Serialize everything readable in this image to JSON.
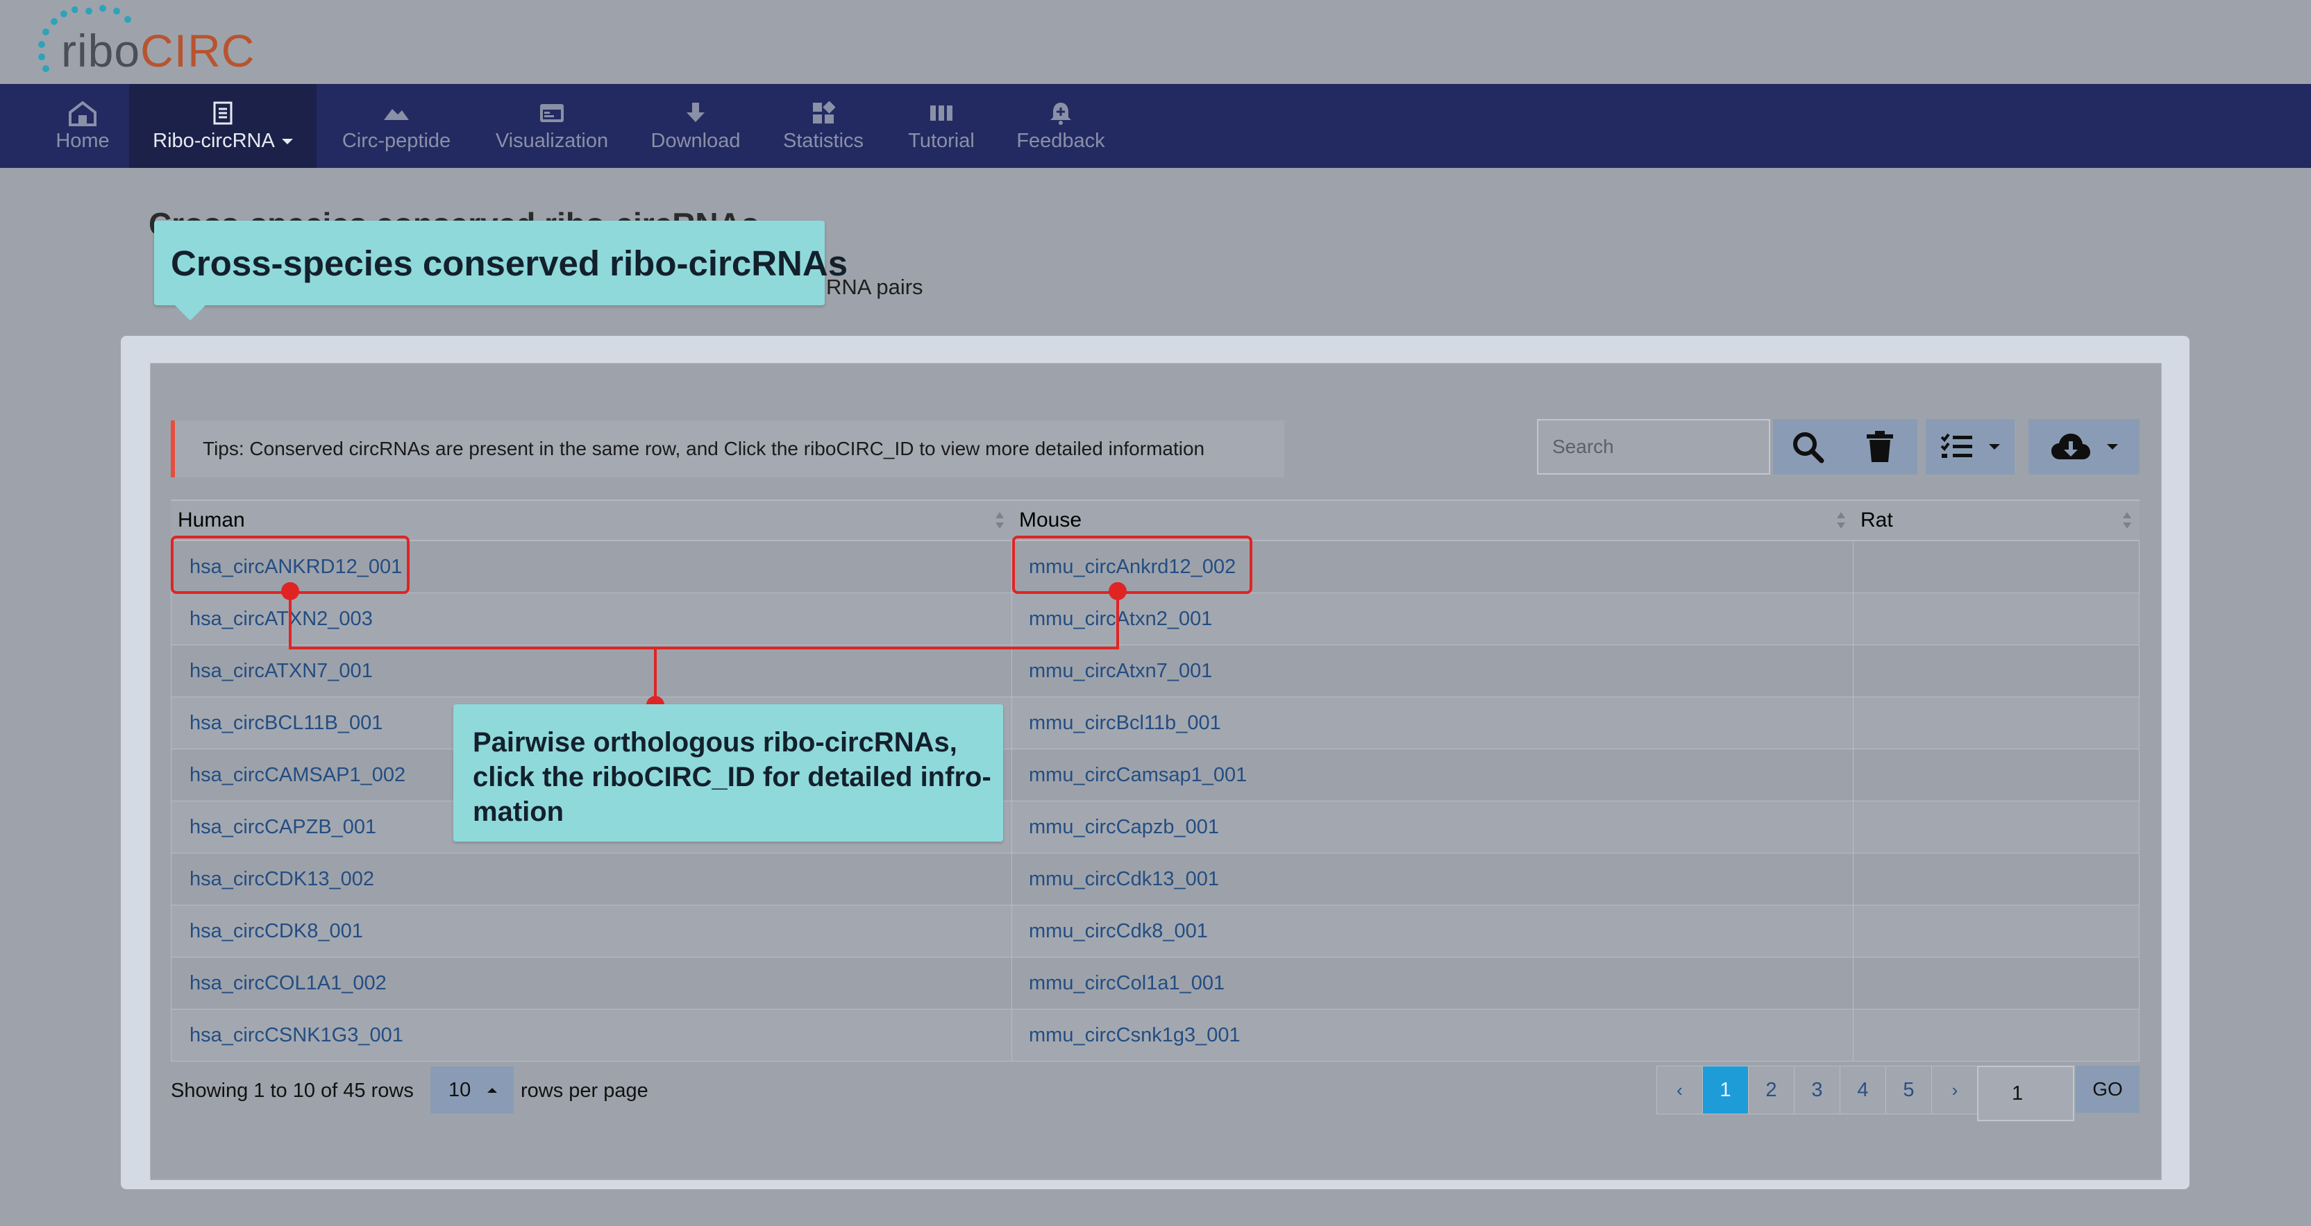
{
  "app": {
    "logo_ribo": "ribo",
    "logo_circ": "CIRC"
  },
  "nav": {
    "items": [
      {
        "label": "Home",
        "icon": "home-icon"
      },
      {
        "label": "Ribo-circRNA",
        "icon": "document-icon",
        "active": true,
        "has_dropdown": true
      },
      {
        "label": "Circ-peptide",
        "icon": "mountain-icon"
      },
      {
        "label": "Visualization",
        "icon": "browser-window-icon"
      },
      {
        "label": "Download",
        "icon": "download-arrow-icon"
      },
      {
        "label": "Statistics",
        "icon": "grid-blocks-icon"
      },
      {
        "label": "Tutorial",
        "icon": "columns-icon"
      },
      {
        "label": "Feedback",
        "icon": "bell-plus-icon"
      }
    ]
  },
  "page": {
    "title": "Cross-species conserved ribo-circRNAs",
    "subtitle_visible": "RNA pairs"
  },
  "tips": "Tips: Conserved circRNAs are present in the same row, and Click the riboCIRC_ID to view more detailed information",
  "toolbar": {
    "search_placeholder": "Search",
    "search_icon": "search-icon",
    "clear_icon": "trash-icon",
    "columns_icon": "list-checks-icon",
    "export_icon": "cloud-download-icon"
  },
  "table": {
    "columns": [
      "Human",
      "Mouse",
      "Rat"
    ],
    "rows": [
      {
        "human": "hsa_circANKRD12_001",
        "mouse": "mmu_circAnkrd12_002",
        "rat": ""
      },
      {
        "human": "hsa_circATXN2_003",
        "mouse": "mmu_circAtxn2_001",
        "rat": ""
      },
      {
        "human": "hsa_circATXN7_001",
        "mouse": "mmu_circAtxn7_001",
        "rat": ""
      },
      {
        "human": "hsa_circBCL11B_001",
        "mouse": "mmu_circBcl11b_001",
        "rat": ""
      },
      {
        "human": "hsa_circCAMSAP1_002",
        "mouse": "mmu_circCamsap1_001",
        "rat": ""
      },
      {
        "human": "hsa_circCAPZB_001",
        "mouse": "mmu_circCapzb_001",
        "rat": ""
      },
      {
        "human": "hsa_circCDK13_002",
        "mouse": "mmu_circCdk13_001",
        "rat": ""
      },
      {
        "human": "hsa_circCDK8_001",
        "mouse": "mmu_circCdk8_001",
        "rat": ""
      },
      {
        "human": "hsa_circCOL1A1_002",
        "mouse": "mmu_circCol1a1_001",
        "rat": ""
      },
      {
        "human": "hsa_circCSNK1G3_001",
        "mouse": "mmu_circCsnk1g3_001",
        "rat": ""
      }
    ]
  },
  "footer": {
    "showing": "Showing 1 to 10 of 45 rows",
    "page_size": "10",
    "rows_per_page": "rows per page",
    "prev": "‹",
    "next": "›",
    "pages": [
      "1",
      "2",
      "3",
      "4",
      "5"
    ],
    "current_page": "1",
    "goto_value": "1",
    "go_label": "GO"
  },
  "annotations": {
    "title_callout": "Cross-species conserved ribo-circRNAs",
    "pair_callout_lines": [
      "Pairwise orthologous ribo-circRNAs,",
      "click the riboCIRC_ID for detailed infro-",
      "mation"
    ]
  },
  "colors": {
    "nav_bg": "#232a61",
    "callout_bg": "#8fd9db",
    "highlight_red": "#e02424",
    "active_page": "#1e9cd8",
    "logo_accent": "#b8542f"
  }
}
